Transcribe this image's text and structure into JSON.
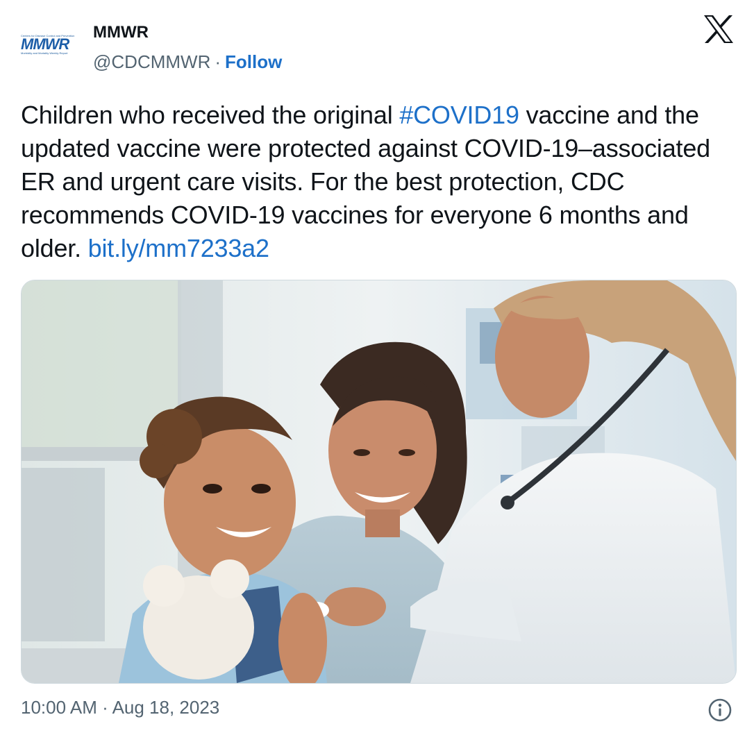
{
  "account": {
    "avatar_tiny_text": "Centers for Disease Control and Prevention",
    "avatar_logo_text": "MMWR",
    "avatar_subtitle": "Morbidity and Mortality Weekly Report",
    "name": "MMWR",
    "handle": "@CDCMMWR",
    "separator": "·",
    "follow_label": "Follow"
  },
  "brand_icon": "x-logo",
  "tweet": {
    "text_1": "Children who received the original ",
    "hashtag": "#COVID19",
    "text_2": " vaccine and the updated vaccine were protected against COVID-19–associated ER and urgent care visits. For the best protection, CDC recommends COVID-19 vaccines for everyone 6 months and older. ",
    "link": "bit.ly/mm7233a2"
  },
  "media": {
    "kind": "photo",
    "icon": "photo-of-doctor-vaccinating-child"
  },
  "footer": {
    "time": "10:00 AM",
    "separator": "·",
    "date": "Aug 18, 2023",
    "info_icon": "info-icon"
  },
  "colors": {
    "link": "#1d70c9",
    "muted": "#536471",
    "text": "#0f1419"
  }
}
